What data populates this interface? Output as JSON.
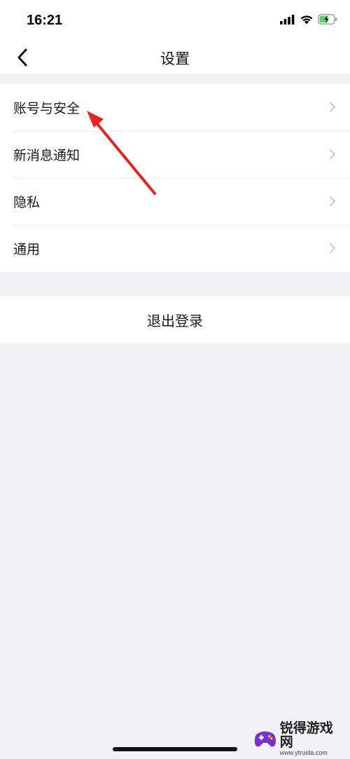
{
  "status_bar": {
    "time": "16:21",
    "icons": [
      "signal-icon",
      "wifi-icon",
      "battery-charging-icon"
    ],
    "battery_color": "#4cd964"
  },
  "nav": {
    "title": "设置",
    "back_icon": "chevron-left-icon"
  },
  "settings": {
    "items": [
      {
        "label": "账号与安全",
        "icon": "chevron-right-icon"
      },
      {
        "label": "新消息通知",
        "icon": "chevron-right-icon"
      },
      {
        "label": "隐私",
        "icon": "chevron-right-icon"
      },
      {
        "label": "通用",
        "icon": "chevron-right-icon"
      }
    ]
  },
  "logout": {
    "label": "退出登录"
  },
  "annotation": {
    "arrow_color": "#e8231f"
  },
  "watermark": {
    "name": "锐得游戏网",
    "url": "www.ytruida.com"
  }
}
